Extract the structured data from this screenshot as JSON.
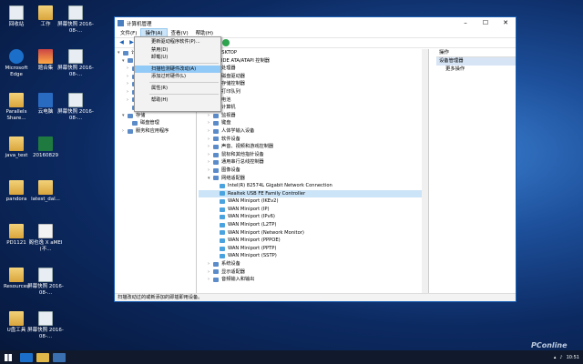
{
  "desktop": {
    "icons_col1": [
      {
        "label": "回收站",
        "icon": "recycle-bin-icon"
      },
      {
        "label": "Microsoft Edge",
        "icon": "edge-icon"
      },
      {
        "label": "Parallels Share...",
        "icon": "folder-icon"
      },
      {
        "label": "java_test",
        "icon": "folder-icon"
      },
      {
        "label": "pandora",
        "icon": "folder-icon"
      },
      {
        "label": "PD1121",
        "icon": "folder-icon"
      },
      {
        "label": "Resources",
        "icon": "folder-icon"
      },
      {
        "label": "U盘工具",
        "icon": "folder-icon"
      }
    ],
    "icons_col2": [
      {
        "label": "工作",
        "icon": "folder-icon"
      },
      {
        "label": "题合集",
        "icon": "image-icon"
      },
      {
        "label": "云电脑",
        "icon": "network-icon"
      },
      {
        "label": "20160829",
        "icon": "excel-icon"
      },
      {
        "label": "latest_dal...",
        "icon": "folder-icon"
      },
      {
        "label": "阁也逸 X aMEI (不...",
        "icon": "audio-icon"
      },
      {
        "label": "屏幕快照 2016-08-...",
        "icon": "screenshot-icon"
      },
      {
        "label": "屏幕快照 2016-08-...",
        "icon": "screenshot-icon"
      }
    ],
    "icons_col3": [
      {
        "label": "屏幕快照 2016-08-...",
        "icon": "screenshot-icon"
      },
      {
        "label": "屏幕快照 2016-08-...",
        "icon": "screenshot-icon"
      },
      {
        "label": "屏幕快照 2016-08-...",
        "icon": "screenshot-icon"
      }
    ]
  },
  "window": {
    "title": "计算机管理",
    "menu": [
      "文件(F)",
      "操作(A)",
      "查看(V)",
      "帮助(H)"
    ],
    "tree": [
      {
        "label": "计算机管理(本地)",
        "arrow": "▾",
        "depth": 0
      },
      {
        "label": "系统工具",
        "arrow": "▾",
        "depth": 1
      },
      {
        "label": "任务计划程序",
        "arrow": "›",
        "depth": 2
      },
      {
        "label": "事件查看器",
        "arrow": "›",
        "depth": 2
      },
      {
        "label": "共享文件夹",
        "arrow": "›",
        "depth": 2
      },
      {
        "label": "本地用户和组",
        "arrow": "›",
        "depth": 2
      },
      {
        "label": "性能",
        "arrow": "›",
        "depth": 2
      },
      {
        "label": "设备管理器",
        "arrow": "",
        "depth": 2
      },
      {
        "label": "存储",
        "arrow": "▾",
        "depth": 1
      },
      {
        "label": "磁盘管理",
        "arrow": "",
        "depth": 2
      },
      {
        "label": "服务和应用程序",
        "arrow": "›",
        "depth": 1
      }
    ],
    "devices": [
      {
        "label": "DESKTOP",
        "arrow": "▾",
        "depth": 0
      },
      {
        "label": "IDE ATA/ATAPI 控制器",
        "arrow": "›",
        "depth": 1
      },
      {
        "label": "处理器",
        "arrow": "›",
        "depth": 1
      },
      {
        "label": "磁盘驱动器",
        "arrow": "›",
        "depth": 1
      },
      {
        "label": "存储控制器",
        "arrow": "›",
        "depth": 1
      },
      {
        "label": "打印队列",
        "arrow": "›",
        "depth": 1
      },
      {
        "label": "电池",
        "arrow": "›",
        "depth": 1
      },
      {
        "label": "计算机",
        "arrow": "›",
        "depth": 1
      },
      {
        "label": "监视器",
        "arrow": "›",
        "depth": 1
      },
      {
        "label": "键盘",
        "arrow": "›",
        "depth": 1
      },
      {
        "label": "人体学输入设备",
        "arrow": "›",
        "depth": 1
      },
      {
        "label": "软件设备",
        "arrow": "›",
        "depth": 1
      },
      {
        "label": "声音、视频和游戏控制器",
        "arrow": "›",
        "depth": 1
      },
      {
        "label": "鼠标和其他指针设备",
        "arrow": "›",
        "depth": 1
      },
      {
        "label": "通用串行总线控制器",
        "arrow": "›",
        "depth": 1
      },
      {
        "label": "图像设备",
        "arrow": "›",
        "depth": 1
      },
      {
        "label": "网络适配器",
        "arrow": "▾",
        "depth": 1
      },
      {
        "label": "Intel(R) 82574L Gigabit Network Connection",
        "arrow": "",
        "depth": 2
      },
      {
        "label": "Realtek USB FE Family Controller",
        "arrow": "",
        "depth": 2,
        "selected": true
      },
      {
        "label": "WAN Miniport (IKEv2)",
        "arrow": "",
        "depth": 2
      },
      {
        "label": "WAN Miniport (IP)",
        "arrow": "",
        "depth": 2
      },
      {
        "label": "WAN Miniport (IPv6)",
        "arrow": "",
        "depth": 2
      },
      {
        "label": "WAN Miniport (L2TP)",
        "arrow": "",
        "depth": 2
      },
      {
        "label": "WAN Miniport (Network Monitor)",
        "arrow": "",
        "depth": 2
      },
      {
        "label": "WAN Miniport (PPPOE)",
        "arrow": "",
        "depth": 2
      },
      {
        "label": "WAN Miniport (PPTP)",
        "arrow": "",
        "depth": 2
      },
      {
        "label": "WAN Miniport (SSTP)",
        "arrow": "",
        "depth": 2
      },
      {
        "label": "系统设备",
        "arrow": "›",
        "depth": 1
      },
      {
        "label": "显示适配器",
        "arrow": "›",
        "depth": 1
      },
      {
        "label": "音频输入和输出",
        "arrow": "›",
        "depth": 1
      }
    ],
    "actions": {
      "header": "操作",
      "group": "设备管理器",
      "more": "更多操作"
    },
    "status": "扫描改动过的或新添加的即插即用设备。"
  },
  "dropdown": [
    {
      "label": "更新驱动程序软件(P)...",
      "type": "item"
    },
    {
      "label": "禁用(D)",
      "type": "item"
    },
    {
      "label": "卸载(U)",
      "type": "item"
    },
    {
      "type": "sep"
    },
    {
      "label": "扫描检测硬件改动(A)",
      "type": "item",
      "highlight": true
    },
    {
      "label": "添加过时硬件(L)",
      "type": "item"
    },
    {
      "type": "sep"
    },
    {
      "label": "属性(R)",
      "type": "item"
    },
    {
      "type": "sep"
    },
    {
      "label": "帮助(H)",
      "type": "item"
    }
  ],
  "taskbar": {
    "time": "10:51",
    "watermark": "PConline"
  }
}
